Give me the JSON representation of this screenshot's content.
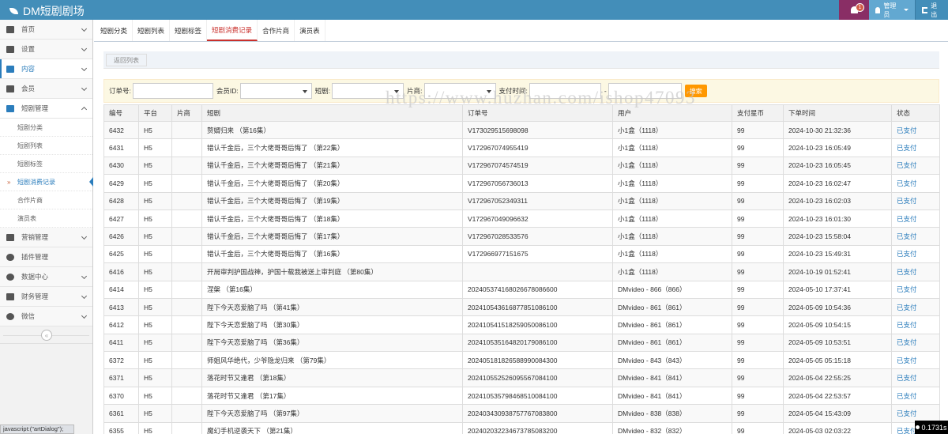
{
  "app": {
    "title": "DM短剧剧场"
  },
  "topnav": {
    "notification_count": "1",
    "user_label": "管理员",
    "logout_label": "退出"
  },
  "sidebar": {
    "items": [
      {
        "label": "首页",
        "icon": "home-icon"
      },
      {
        "label": "设置",
        "icon": "gear-icon"
      },
      {
        "label": "内容",
        "icon": "file-icon"
      },
      {
        "label": "会员",
        "icon": "user-icon"
      },
      {
        "label": "短剧管理",
        "icon": "desktop-icon"
      }
    ],
    "sub_items": [
      {
        "label": "短剧分类"
      },
      {
        "label": "短剧列表"
      },
      {
        "label": "短剧标签"
      },
      {
        "label": "短剧消费记录"
      },
      {
        "label": "合作片商"
      },
      {
        "label": "演员表"
      }
    ],
    "items_after": [
      {
        "label": "营销管理",
        "icon": "users-icon"
      },
      {
        "label": "插件管理",
        "icon": "cloud-icon"
      },
      {
        "label": "数据中心",
        "icon": "pie-chart-icon"
      },
      {
        "label": "财务管理",
        "icon": "money-icon"
      },
      {
        "label": "微信",
        "icon": "wechat-icon"
      }
    ],
    "collapse_glyph": "«"
  },
  "tabs": [
    {
      "label": "短剧分类"
    },
    {
      "label": "短剧列表"
    },
    {
      "label": "短剧标签"
    },
    {
      "label": "短剧消费记录"
    },
    {
      "label": "合作片商"
    },
    {
      "label": "演员表"
    }
  ],
  "back_button": "返回列表",
  "filters": {
    "order_no": "订单号:",
    "member_id": "会员ID:",
    "drama": "短剧:",
    "vendor": "片商:",
    "pay_time": "支付时间:",
    "range_sep": "-",
    "search": "搜索"
  },
  "table": {
    "headers": [
      "编号",
      "平台",
      "片商",
      "短剧",
      "订单号",
      "用户",
      "支付星币",
      "下单时间",
      "状态"
    ],
    "rows": [
      [
        "6432",
        "H5",
        "",
        "赘婿归来 （第16集）",
        "V173029515698098",
        "小1盒（1118）",
        "99",
        "2024-10-30 21:32:36",
        "已支付"
      ],
      [
        "6431",
        "H5",
        "",
        "错认千金后，三个大佬哥哥后悔了 （第22集）",
        "V172967074955419",
        "小1盒（1118）",
        "99",
        "2024-10-23 16:05:49",
        "已支付"
      ],
      [
        "6430",
        "H5",
        "",
        "错认千金后，三个大佬哥哥后悔了 （第21集）",
        "V172967074574519",
        "小1盒（1118）",
        "99",
        "2024-10-23 16:05:45",
        "已支付"
      ],
      [
        "6429",
        "H5",
        "",
        "错认千金后，三个大佬哥哥后悔了 （第20集）",
        "V172967056736013",
        "小1盒（1118）",
        "99",
        "2024-10-23 16:02:47",
        "已支付"
      ],
      [
        "6428",
        "H5",
        "",
        "错认千金后，三个大佬哥哥后悔了 （第19集）",
        "V172967052349311",
        "小1盒（1118）",
        "99",
        "2024-10-23 16:02:03",
        "已支付"
      ],
      [
        "6427",
        "H5",
        "",
        "错认千金后，三个大佬哥哥后悔了 （第18集）",
        "V172967049096632",
        "小1盒（1118）",
        "99",
        "2024-10-23 16:01:30",
        "已支付"
      ],
      [
        "6426",
        "H5",
        "",
        "错认千金后，三个大佬哥哥后悔了 （第17集）",
        "V172967028533576",
        "小1盒（1118）",
        "99",
        "2024-10-23 15:58:04",
        "已支付"
      ],
      [
        "6425",
        "H5",
        "",
        "错认千金后，三个大佬哥哥后悔了 （第16集）",
        "V172966977151675",
        "小1盒（1118）",
        "99",
        "2024-10-23 15:49:31",
        "已支付"
      ],
      [
        "6416",
        "H5",
        "",
        "开局审判护国战神，护国十载我被送上审判庭 （第80集）",
        "",
        "小1盒（1118）",
        "99",
        "2024-10-19 01:52:41",
        "已支付"
      ],
      [
        "6414",
        "H5",
        "",
        "涅槃 （第16集）",
        "20240537416802667808660​0",
        "DMvideo - 866（866）",
        "99",
        "2024-05-10 17:37:41",
        "已支付"
      ],
      [
        "6413",
        "H5",
        "",
        "陛下今天恋爱脑了吗 （第41集）",
        "20241054361687785108610​0",
        "DMvideo - 861（861）",
        "99",
        "2024-05-09 10:54:36",
        "已支付"
      ],
      [
        "6412",
        "H5",
        "",
        "陛下今天恋爱脑了吗 （第30集）",
        "20241054151825905008610​0",
        "DMvideo - 861（861）",
        "99",
        "2024-05-09 10:54:15",
        "已支付"
      ],
      [
        "6411",
        "H5",
        "",
        "陛下今天恋爱脑了吗 （第36集）",
        "20241053516482017908610​0",
        "DMvideo - 861（861）",
        "99",
        "2024-05-09 10:53:51",
        "已支付"
      ],
      [
        "6372",
        "H5",
        "",
        "师姐风华绝代，少爷隐龙归来 （第79集）",
        "20240518182658899008430​0",
        "DMvideo - 843（843）",
        "99",
        "2024-05-05 05:15:18",
        "已支付"
      ],
      [
        "6371",
        "H5",
        "",
        "落花时节又逢君 （第18集）",
        "20241055252609556708410​0",
        "DMvideo - 841（841）",
        "99",
        "2024-05-04 22:55:25",
        "已支付"
      ],
      [
        "6370",
        "H5",
        "",
        "落花时节又逢君 （第17集）",
        "20241053579846851008410​0",
        "DMvideo - 841（841）",
        "99",
        "2024-05-04 22:53:57",
        "已支付"
      ],
      [
        "6361",
        "H5",
        "",
        "陛下今天恋爱脑了吗 （第97集）",
        "20240343093875776708380​0",
        "DMvideo - 838（838）",
        "99",
        "2024-05-04 15:43:09",
        "已支付"
      ],
      [
        "6355",
        "H5",
        "",
        "魔幻手机逆袭天下 （第21集）",
        "20240203223467378508320​0",
        "DMvideo - 832（832）",
        "99",
        "2024-05-03 02:03:22",
        "已支付"
      ]
    ]
  },
  "watermark": "https://www.huzhan.com/ishop47093",
  "status_bar": "javascript:(\"artDialog\");",
  "timer": "0.1731s"
}
